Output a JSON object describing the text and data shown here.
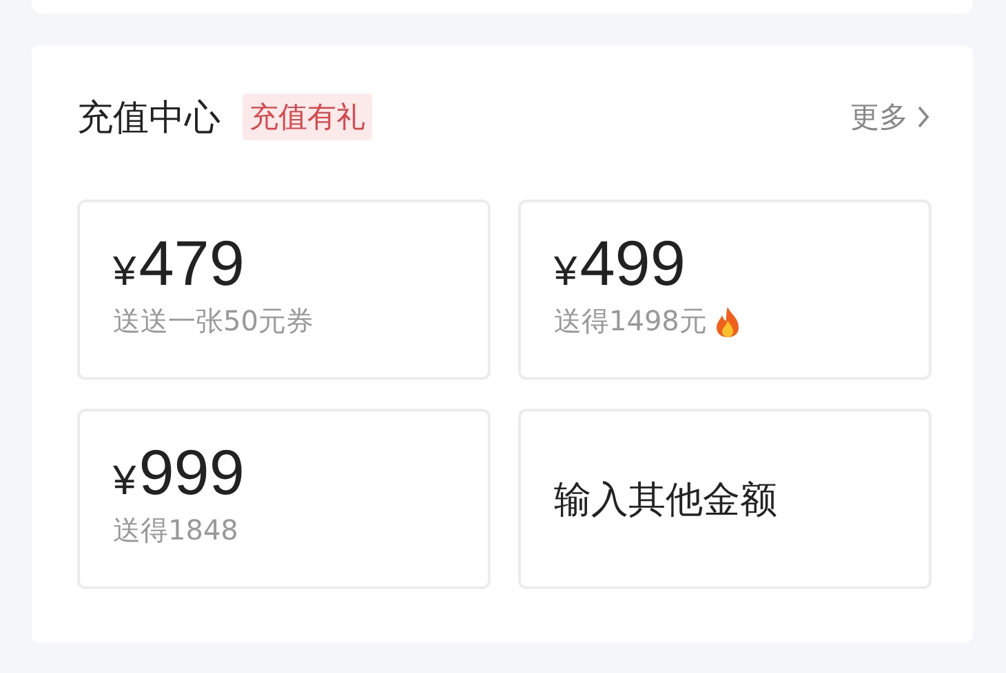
{
  "section": {
    "title": "充值中心",
    "badge": "充值有礼",
    "more": "更多"
  },
  "options": [
    {
      "kind": "amount",
      "currency": "¥",
      "amount": "479",
      "bonus": "送送一张50元券",
      "hot": false
    },
    {
      "kind": "amount",
      "currency": "¥",
      "amount": "499",
      "bonus": "送得1498元",
      "hot": true
    },
    {
      "kind": "amount",
      "currency": "¥",
      "amount": "999",
      "bonus": "送得1848",
      "hot": false
    },
    {
      "kind": "custom",
      "label": "输入其他金额"
    }
  ]
}
